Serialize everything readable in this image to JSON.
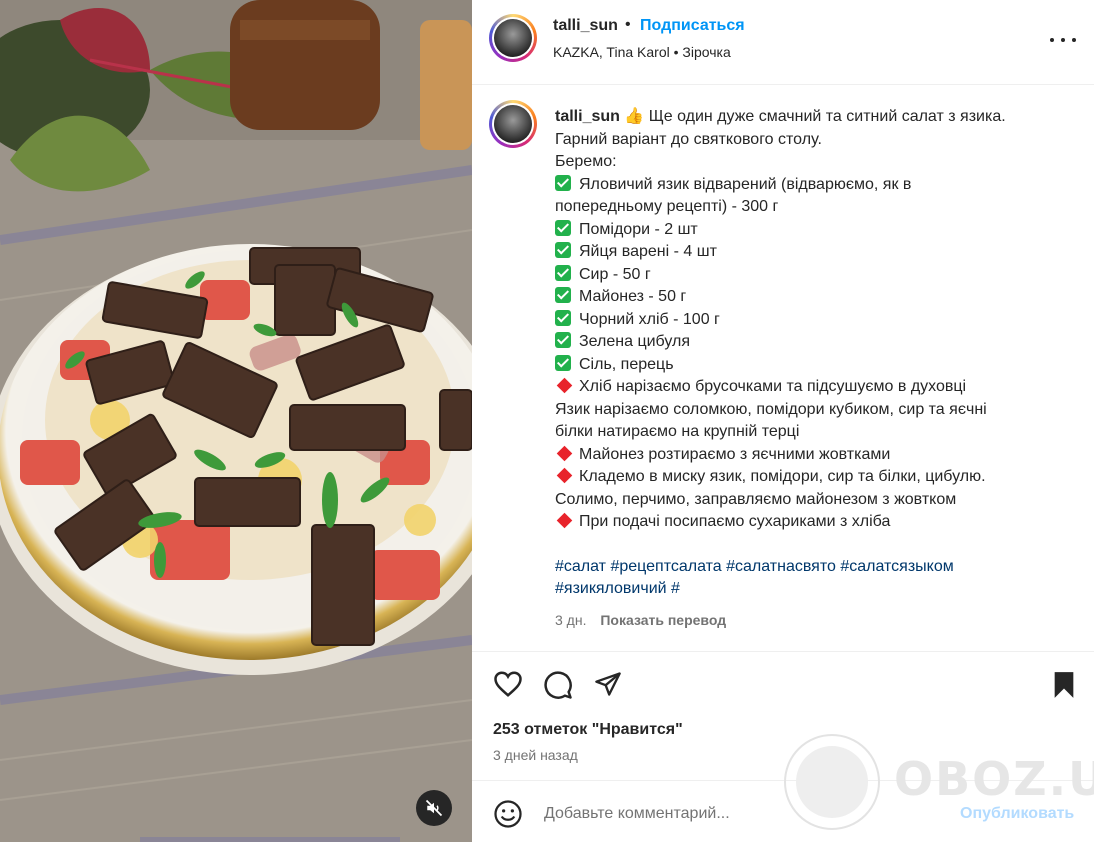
{
  "post": {
    "username": "talli_sun",
    "dot": "•",
    "follow_label": "Подписаться",
    "audio": "KAZKA, Tina Karol • Зірочка"
  },
  "caption": {
    "username": "talli_sun",
    "intro_emoji": "👍",
    "intro_1": "Ще один дуже смачний та ситний салат з язика.",
    "intro_2": "Гарний варіант до святкового столу.",
    "take": "Беремо:",
    "ingredients": [
      "Яловичий язик відварений (відварюємо, як в",
      "Помідори - 2 шт",
      "Яйця варені - 4 шт",
      "Сир - 50 г",
      "Майонез - 50 г",
      "Чорний хліб - 100 г",
      "Зелена цибуля",
      "Сіль, перець"
    ],
    "ingredient_1_cont": "попередньому рецепті) - 300 г",
    "steps": [
      "Хліб нарізаємо брусочками та підсушуємо в духовці",
      "Майонез розтираємо з яєчними жовтками",
      "Кладемо в миску язик, помідори, сир та білки, цибулю.",
      "При подачі посипаємо сухариками з хліба"
    ],
    "step_1_cont_a": "Язик нарізаємо соломкою, помідори кубиком, сир та яєчні",
    "step_1_cont_b": "білки натираємо на крупній терці",
    "step_3_cont": "Солимо, перчимо, заправляємо майонезом з жовтком",
    "hashtags_1": "#салат #рецептсалата #салатнасвято #салатсязыком",
    "hashtags_2": "#язикяловичий #",
    "time": "3 дн.",
    "translate": "Показать перевод"
  },
  "stats": {
    "likes": "253 отметок \"Нравится\"",
    "ago": "3 дней назад"
  },
  "comment": {
    "placeholder": "Добавьте комментарий...",
    "publish": "Опубликовать"
  },
  "watermark": "OBOZ.UA",
  "icons": {
    "like": "heart-icon",
    "comment": "comment-icon",
    "share": "paper-plane-icon",
    "save": "bookmark-icon",
    "emoji": "smiley-icon",
    "mute": "speaker-muted-icon",
    "more": "more-options-icon"
  },
  "colors": {
    "accent": "#0095f6",
    "check": "#22b14c",
    "diamond": "#e8232b",
    "hashtag": "#00376b"
  }
}
